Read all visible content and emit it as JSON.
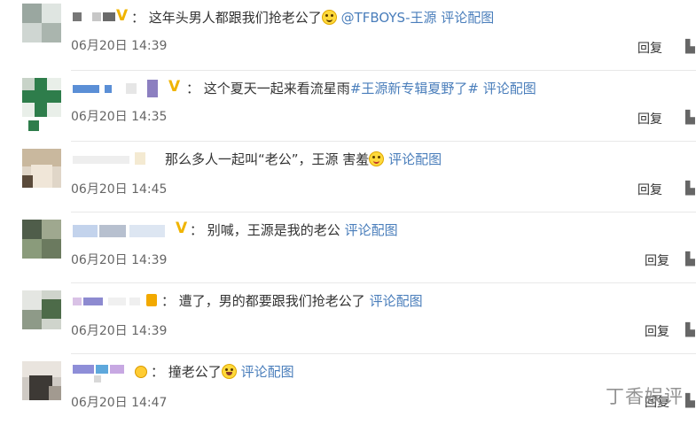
{
  "comments": [
    {
      "text": "这年头男人都跟我们抢老公了",
      "mention": "@TFBOYS-王源",
      "tag": "评论配图",
      "time": "06月20日 14:39",
      "reply": "回复",
      "emoji": "crying-face"
    },
    {
      "text": "这个夏天一起来看流星雨",
      "hashtag": "#王源新专辑夏野了#",
      "tag": "评论配图",
      "time": "06月20日 14:35",
      "reply": "回复"
    },
    {
      "text": "那么多人一起叫“老公”，王源 害羞",
      "tag": "评论配图",
      "time": "06月20日 14:45",
      "reply": "回复",
      "emoji": "shy-face"
    },
    {
      "text": "别喊，王源是我的老公",
      "tag": "评论配图",
      "time": "06月20日 14:39",
      "reply": "回复"
    },
    {
      "text": "遭了，男的都要跟我们抢老公了",
      "tag": "评论配图",
      "time": "06月20日 14:39",
      "reply": "回复"
    },
    {
      "text": "撞老公了",
      "tag": "评论配图",
      "time": "06月20日 14:47",
      "reply": "回复",
      "emoji": "laughing-face"
    }
  ],
  "watermark": "丁香娱评",
  "colors": {
    "link": "#4a7ebb",
    "badge": "#f0b400",
    "divider": "#e8e8e8"
  }
}
